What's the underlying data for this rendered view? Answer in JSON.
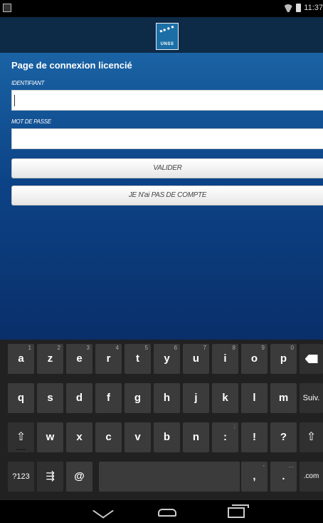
{
  "status_bar": {
    "time": "11:37",
    "icons": [
      "notification-icon",
      "wifi-icon",
      "battery-icon"
    ]
  },
  "header": {
    "logo_text": "UNSS"
  },
  "form": {
    "title": "Page de connexion licencié",
    "identifier_label": "IDENTIFIANT",
    "identifier_value": "",
    "password_label": "MOT DE PASSE",
    "password_value": "",
    "submit_label": "VALIDER",
    "no_account_label": "JE N'ai PAS DE COMPTE"
  },
  "keyboard": {
    "row1": [
      {
        "k": "a",
        "h": "1"
      },
      {
        "k": "z",
        "h": "2"
      },
      {
        "k": "e",
        "h": "3"
      },
      {
        "k": "r",
        "h": "4"
      },
      {
        "k": "t",
        "h": "5"
      },
      {
        "k": "y",
        "h": "6"
      },
      {
        "k": "u",
        "h": "7"
      },
      {
        "k": "i",
        "h": "8"
      },
      {
        "k": "o",
        "h": "9"
      },
      {
        "k": "p",
        "h": "0"
      }
    ],
    "row2": [
      "q",
      "s",
      "d",
      "f",
      "g",
      "h",
      "j",
      "k",
      "l",
      "m"
    ],
    "row3": [
      {
        "k": "w",
        "h": ""
      },
      {
        "k": "x",
        "h": ""
      },
      {
        "k": "c",
        "h": ""
      },
      {
        "k": "v",
        "h": ""
      },
      {
        "k": "b",
        "h": ""
      },
      {
        "k": "n",
        "h": ""
      },
      {
        "k": ":",
        "h": ";"
      },
      {
        "k": "!",
        "h": ""
      },
      {
        "k": "?",
        "h": ""
      }
    ],
    "next_label": "Suiv.",
    "symbols_label": "?123",
    "settings_glyph": "⇶",
    "at_label": "@",
    "comma_label": ",",
    "comma_hint": "-",
    "period_label": ".",
    "period_hint": "…",
    "com_label": ".com",
    "shift_glyph": "⇧"
  },
  "colors": {
    "header_bg": "#0d2a47",
    "main_top": "#1a63a4",
    "main_bottom": "#0a2f6a",
    "keyboard_bg": "#212121"
  }
}
